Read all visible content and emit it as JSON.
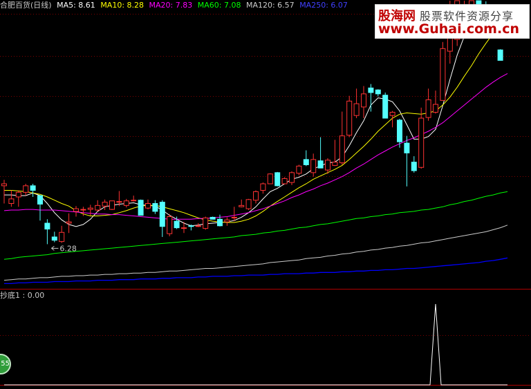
{
  "legend": {
    "stock_name": "合肥百货(日线)",
    "ma5": "MA5: 8.61",
    "ma10": "MA10: 8.28",
    "ma20": "MA20: 7.83",
    "ma60": "MA60: 7.08",
    "ma120": "MA120: 6.57",
    "ma250": "MA250: 6.07"
  },
  "indicator": {
    "label": "抄底1 : 0.00"
  },
  "logo": {
    "cn1": "股海网",
    "cn2": "股票软件资源分享",
    "url": "www.Guhai.com.cn"
  },
  "badge": {
    "text": "55"
  },
  "colors": {
    "up": "#ff3232",
    "down": "#54ffff",
    "ma5": "#ffffff",
    "ma10": "#ffff00",
    "ma20": "#ff00ff",
    "ma60": "#00ff00",
    "ma120": "#cccccc",
    "ma250": "#0000ff",
    "grid": "#800000",
    "divider": "#b00000"
  },
  "chart_data": [
    {
      "type": "candlestick",
      "ylim": [
        5.6,
        10.0
      ],
      "grid": true,
      "annotations": [
        {
          "text": "6.28",
          "bar_index": 6,
          "value": 6.28
        }
      ],
      "candles": [
        {
          "o": 7.17,
          "h": 7.26,
          "l": 6.9,
          "c": 7.2
        },
        {
          "o": 6.9,
          "h": 7.1,
          "l": 6.85,
          "c": 6.97
        },
        {
          "o": 7.0,
          "h": 7.1,
          "l": 6.85,
          "c": 7.07
        },
        {
          "o": 7.07,
          "h": 7.2,
          "l": 7.02,
          "c": 7.17
        },
        {
          "o": 7.17,
          "h": 7.2,
          "l": 7.0,
          "c": 7.1
        },
        {
          "o": 7.02,
          "h": 7.03,
          "l": 6.64,
          "c": 6.89
        },
        {
          "o": 6.6,
          "h": 6.66,
          "l": 6.28,
          "c": 6.51
        },
        {
          "o": 6.39,
          "h": 6.47,
          "l": 6.31,
          "c": 6.34
        },
        {
          "o": 6.32,
          "h": 6.56,
          "l": 6.3,
          "c": 6.46
        },
        {
          "o": 6.6,
          "h": 6.75,
          "l": 6.45,
          "c": 6.62
        },
        {
          "o": 6.78,
          "h": 6.86,
          "l": 6.7,
          "c": 6.82
        },
        {
          "o": 6.81,
          "h": 6.85,
          "l": 6.71,
          "c": 6.81
        },
        {
          "o": 6.81,
          "h": 6.88,
          "l": 6.72,
          "c": 6.83
        },
        {
          "o": 6.8,
          "h": 6.95,
          "l": 6.78,
          "c": 6.87
        },
        {
          "o": 6.86,
          "h": 6.96,
          "l": 6.8,
          "c": 6.92
        },
        {
          "o": 6.81,
          "h": 6.94,
          "l": 6.8,
          "c": 6.94
        },
        {
          "o": 6.92,
          "h": 7.09,
          "l": 6.86,
          "c": 6.93
        },
        {
          "o": 6.87,
          "h": 6.97,
          "l": 6.84,
          "c": 6.94
        },
        {
          "o": 6.94,
          "h": 7.02,
          "l": 6.93,
          "c": 6.95
        },
        {
          "o": 6.95,
          "h": 6.96,
          "l": 6.72,
          "c": 6.72
        },
        {
          "o": 6.83,
          "h": 6.96,
          "l": 6.81,
          "c": 6.9
        },
        {
          "o": 6.9,
          "h": 6.95,
          "l": 6.74,
          "c": 6.78
        },
        {
          "o": 6.92,
          "h": 6.95,
          "l": 6.39,
          "c": 6.55
        },
        {
          "o": 6.44,
          "h": 6.74,
          "l": 6.4,
          "c": 6.7
        },
        {
          "o": 6.63,
          "h": 6.7,
          "l": 6.51,
          "c": 6.53
        },
        {
          "o": 6.52,
          "h": 6.62,
          "l": 6.45,
          "c": 6.53
        },
        {
          "o": 6.56,
          "h": 6.58,
          "l": 6.49,
          "c": 6.55
        },
        {
          "o": 6.55,
          "h": 6.6,
          "l": 6.54,
          "c": 6.56
        },
        {
          "o": 6.52,
          "h": 6.7,
          "l": 6.5,
          "c": 6.68
        },
        {
          "o": 6.69,
          "h": 6.7,
          "l": 6.66,
          "c": 6.66
        },
        {
          "o": 6.66,
          "h": 6.73,
          "l": 6.55,
          "c": 6.56
        },
        {
          "o": 6.62,
          "h": 6.69,
          "l": 6.56,
          "c": 6.65
        },
        {
          "o": 6.68,
          "h": 6.85,
          "l": 6.63,
          "c": 6.69
        },
        {
          "o": 6.85,
          "h": 6.96,
          "l": 6.84,
          "c": 6.87
        },
        {
          "o": 6.82,
          "h": 6.97,
          "l": 6.8,
          "c": 6.96
        },
        {
          "o": 6.95,
          "h": 7.1,
          "l": 6.9,
          "c": 7.08
        },
        {
          "o": 7.1,
          "h": 7.22,
          "l": 7.05,
          "c": 7.2
        },
        {
          "o": 7.2,
          "h": 7.36,
          "l": 7.2,
          "c": 7.35
        },
        {
          "o": 7.37,
          "h": 7.38,
          "l": 7.16,
          "c": 7.17
        },
        {
          "o": 7.2,
          "h": 7.3,
          "l": 7.19,
          "c": 7.28
        },
        {
          "o": 7.22,
          "h": 7.39,
          "l": 7.18,
          "c": 7.37
        },
        {
          "o": 7.36,
          "h": 7.49,
          "l": 7.33,
          "c": 7.47
        },
        {
          "o": 7.57,
          "h": 7.71,
          "l": 7.47,
          "c": 7.49
        },
        {
          "o": 7.37,
          "h": 7.66,
          "l": 7.31,
          "c": 7.57
        },
        {
          "o": 7.55,
          "h": 7.91,
          "l": 7.44,
          "c": 7.44
        },
        {
          "o": 7.41,
          "h": 7.59,
          "l": 7.35,
          "c": 7.56
        },
        {
          "o": 7.48,
          "h": 7.87,
          "l": 7.47,
          "c": 7.53
        },
        {
          "o": 7.52,
          "h": 8.3,
          "l": 7.49,
          "c": 7.93
        },
        {
          "o": 7.94,
          "h": 8.54,
          "l": 7.91,
          "c": 8.46
        },
        {
          "o": 8.24,
          "h": 8.65,
          "l": 8.2,
          "c": 8.42
        },
        {
          "o": 8.37,
          "h": 8.69,
          "l": 8.2,
          "c": 8.57
        },
        {
          "o": 8.66,
          "h": 8.72,
          "l": 8.3,
          "c": 8.59
        },
        {
          "o": 8.63,
          "h": 8.64,
          "l": 8.53,
          "c": 8.57
        },
        {
          "o": 8.55,
          "h": 8.59,
          "l": 8.2,
          "c": 8.2
        },
        {
          "o": 8.24,
          "h": 8.31,
          "l": 8.06,
          "c": 8.29
        },
        {
          "o": 8.17,
          "h": 8.19,
          "l": 7.75,
          "c": 7.84
        },
        {
          "o": 7.82,
          "h": 7.93,
          "l": 7.16,
          "c": 7.67
        },
        {
          "o": 7.53,
          "h": 7.62,
          "l": 7.37,
          "c": 7.4
        },
        {
          "o": 7.45,
          "h": 8.36,
          "l": 7.43,
          "c": 8.2
        },
        {
          "o": 8.21,
          "h": 8.65,
          "l": 8.16,
          "c": 8.48
        },
        {
          "o": 8.29,
          "h": 8.62,
          "l": 8.27,
          "c": 8.41
        },
        {
          "o": 8.47,
          "h": 9.36,
          "l": 8.47,
          "c": 9.26
        },
        {
          "o": 9.22,
          "h": 10.1,
          "l": 9.03,
          "c": 9.61
        },
        {
          "o": 9.4,
          "h": 10.1,
          "l": 9.3,
          "c": 10.1
        },
        {
          "o": 9.75,
          "h": 10.1,
          "l": 9.7,
          "c": 9.77
        },
        {
          "o": 9.8,
          "h": 10.1,
          "l": 9.8,
          "c": 10.1
        },
        {
          "o": 10.1,
          "h": 10.1,
          "l": 9.85,
          "c": 9.9
        },
        {
          "o": 9.9,
          "h": 9.98,
          "l": 9.44,
          "c": 9.62
        },
        {
          "o": 9.57,
          "h": 9.65,
          "l": 9.45,
          "c": 9.5
        },
        {
          "o": 9.24,
          "h": 9.25,
          "l": 9.17,
          "c": 9.08
        }
      ],
      "ma": {
        "ma5": [
          7.03,
          7.03,
          7.02,
          7.02,
          7.06,
          7.02,
          6.9,
          6.76,
          6.65,
          6.58,
          6.55,
          6.58,
          6.66,
          6.78,
          6.85,
          6.87,
          6.89,
          6.9,
          6.91,
          6.88,
          6.87,
          6.86,
          6.8,
          6.72,
          6.66,
          6.6,
          6.56,
          6.57,
          6.59,
          6.6,
          6.61,
          6.62,
          6.64,
          6.69,
          6.76,
          6.85,
          6.97,
          7.08,
          7.13,
          7.2,
          7.27,
          7.3,
          7.35,
          7.43,
          7.47,
          7.52,
          7.53,
          7.61,
          7.78,
          7.98,
          8.16,
          8.4,
          8.51,
          8.49,
          8.45,
          8.31,
          8.1,
          7.88,
          7.88,
          7.92,
          8.03,
          8.39,
          8.79,
          9.16,
          9.45,
          9.65,
          9.85,
          9.88,
          9.86,
          9.77,
          9.68
        ],
        "ma10": [
          7.1,
          7.1,
          7.09,
          7.08,
          7.06,
          7.04,
          7.0,
          6.95,
          6.9,
          6.86,
          6.79,
          6.74,
          6.71,
          6.71,
          6.72,
          6.73,
          6.76,
          6.79,
          6.83,
          6.86,
          6.87,
          6.87,
          6.85,
          6.82,
          6.79,
          6.76,
          6.72,
          6.68,
          6.65,
          6.63,
          6.62,
          6.61,
          6.61,
          6.63,
          6.66,
          6.71,
          6.78,
          6.86,
          6.93,
          7.0,
          7.07,
          7.14,
          7.2,
          7.27,
          7.32,
          7.37,
          7.42,
          7.48,
          7.57,
          7.67,
          7.77,
          7.88,
          8.0,
          8.1,
          8.2,
          8.26,
          8.28,
          8.27,
          8.26,
          8.28,
          8.31,
          8.4,
          8.52,
          8.67,
          8.84,
          9.0,
          9.18,
          9.34,
          9.49,
          9.56,
          9.6
        ],
        "ma20": [
          6.79,
          6.8,
          6.8,
          6.81,
          6.81,
          6.8,
          6.8,
          6.8,
          6.79,
          6.78,
          6.77,
          6.76,
          6.75,
          6.74,
          6.74,
          6.73,
          6.73,
          6.72,
          6.71,
          6.7,
          6.69,
          6.68,
          6.67,
          6.66,
          6.66,
          6.66,
          6.66,
          6.67,
          6.67,
          6.68,
          6.69,
          6.7,
          6.72,
          6.74,
          6.76,
          6.79,
          6.82,
          6.86,
          6.9,
          6.94,
          6.99,
          7.03,
          7.08,
          7.12,
          7.17,
          7.21,
          7.26,
          7.31,
          7.37,
          7.44,
          7.5,
          7.57,
          7.64,
          7.7,
          7.76,
          7.81,
          7.86,
          7.9,
          7.95,
          8.0,
          8.06,
          8.13,
          8.22,
          8.31,
          8.4,
          8.49,
          8.58,
          8.67,
          8.75,
          8.82,
          8.88
        ],
        "ma60": [
          6.05,
          6.06,
          6.08,
          6.09,
          6.1,
          6.11,
          6.12,
          6.14,
          6.15,
          6.16,
          6.17,
          6.18,
          6.19,
          6.2,
          6.21,
          6.22,
          6.23,
          6.24,
          6.25,
          6.26,
          6.27,
          6.28,
          6.29,
          6.3,
          6.31,
          6.32,
          6.33,
          6.34,
          6.35,
          6.36,
          6.37,
          6.38,
          6.39,
          6.41,
          6.42,
          6.43,
          6.45,
          6.46,
          6.48,
          6.49,
          6.51,
          6.53,
          6.54,
          6.56,
          6.58,
          6.59,
          6.61,
          6.63,
          6.65,
          6.67,
          6.68,
          6.7,
          6.71,
          6.73,
          6.74,
          6.76,
          6.77,
          6.78,
          6.8,
          6.81,
          6.83,
          6.85,
          6.88,
          6.9,
          6.93,
          6.95,
          6.98,
          7.01,
          7.03,
          7.06,
          7.08
        ],
        "ma120": [
          5.73,
          5.74,
          5.75,
          5.75,
          5.76,
          5.77,
          5.77,
          5.78,
          5.79,
          5.79,
          5.8,
          5.8,
          5.81,
          5.81,
          5.82,
          5.82,
          5.83,
          5.83,
          5.84,
          5.84,
          5.85,
          5.85,
          5.86,
          5.87,
          5.87,
          5.88,
          5.89,
          5.9,
          5.91,
          5.91,
          5.92,
          5.93,
          5.94,
          5.95,
          5.96,
          5.97,
          5.98,
          6.0,
          6.01,
          6.02,
          6.03,
          6.04,
          6.06,
          6.07,
          6.08,
          6.1,
          6.11,
          6.13,
          6.14,
          6.16,
          6.17,
          6.19,
          6.2,
          6.22,
          6.23,
          6.25,
          6.26,
          6.28,
          6.3,
          6.31,
          6.33,
          6.35,
          6.37,
          6.39,
          6.41,
          6.43,
          6.45,
          6.47,
          6.5,
          6.53,
          6.57
        ],
        "ma250": [
          5.68,
          5.68,
          5.69,
          5.69,
          5.7,
          5.7,
          5.7,
          5.71,
          5.71,
          5.71,
          5.72,
          5.72,
          5.72,
          5.73,
          5.73,
          5.73,
          5.74,
          5.74,
          5.74,
          5.75,
          5.75,
          5.75,
          5.76,
          5.76,
          5.77,
          5.77,
          5.77,
          5.78,
          5.78,
          5.79,
          5.79,
          5.79,
          5.8,
          5.8,
          5.81,
          5.81,
          5.81,
          5.82,
          5.82,
          5.83,
          5.83,
          5.83,
          5.84,
          5.84,
          5.85,
          5.85,
          5.85,
          5.86,
          5.86,
          5.87,
          5.87,
          5.88,
          5.88,
          5.89,
          5.89,
          5.9,
          5.91,
          5.91,
          5.92,
          5.93,
          5.94,
          5.95,
          5.96,
          5.97,
          5.98,
          5.99,
          6.0,
          6.02,
          6.03,
          6.05,
          6.07
        ]
      }
    },
    {
      "type": "line",
      "series_label": "抄底1",
      "current_value": 0.0,
      "ylim": [
        0,
        1
      ],
      "values": [
        0,
        0,
        0,
        0,
        0,
        0,
        0,
        0,
        0,
        0,
        0,
        0,
        0,
        0,
        0,
        0,
        0,
        0,
        0,
        0,
        0,
        0,
        0,
        0,
        0,
        0,
        0,
        0,
        0,
        0,
        0,
        0,
        0,
        0,
        0,
        0,
        0,
        0,
        0,
        0,
        0,
        0,
        0,
        0,
        0,
        0,
        0,
        0,
        0,
        0,
        0,
        0,
        0,
        0,
        0,
        0,
        0,
        0,
        0,
        0,
        1,
        0,
        0,
        0,
        0,
        0,
        0,
        0,
        0,
        0,
        0
      ]
    }
  ]
}
